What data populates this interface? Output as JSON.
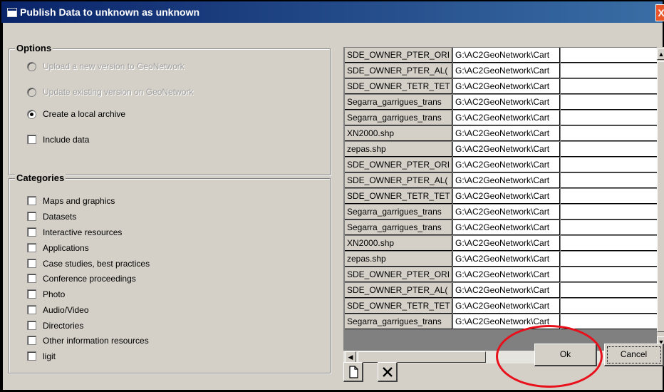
{
  "window": {
    "title": "Publish Data to unknown as unknown",
    "close_label": "X"
  },
  "options": {
    "title": "Options",
    "radios": [
      {
        "label": "Upload a new version to GeoNetwork",
        "selected": false,
        "enabled": false
      },
      {
        "label": "Update existing version on GeoNetwork",
        "selected": false,
        "enabled": false
      },
      {
        "label": "Create a local archive",
        "selected": true,
        "enabled": true
      }
    ],
    "include_data": {
      "label": "Include data",
      "checked": false
    }
  },
  "categories": {
    "title": "Categories",
    "items": [
      "Maps and graphics",
      "Datasets",
      "Interactive resources",
      "Applications",
      "Case studies, best practices",
      "Conference proceedings",
      "Photo",
      "Audio/Video",
      "Directories",
      "Other information resources",
      "ligit"
    ]
  },
  "grid": {
    "rows": [
      [
        "SDE_OWNER_PTER_ORI",
        "G:\\AC2GeoNetwork\\Cart",
        ""
      ],
      [
        "SDE_OWNER_PTER_AL(",
        "G:\\AC2GeoNetwork\\Cart",
        ""
      ],
      [
        "SDE_OWNER_TETR_TET",
        "G:\\AC2GeoNetwork\\Cart",
        ""
      ],
      [
        "Segarra_garrigues_trans",
        "G:\\AC2GeoNetwork\\Cart",
        ""
      ],
      [
        "Segarra_garrigues_trans",
        "G:\\AC2GeoNetwork\\Cart",
        ""
      ],
      [
        "XN2000.shp",
        "G:\\AC2GeoNetwork\\Cart",
        ""
      ],
      [
        "zepas.shp",
        "G:\\AC2GeoNetwork\\Cart",
        ""
      ],
      [
        "SDE_OWNER_PTER_ORI",
        "G:\\AC2GeoNetwork\\Cart",
        ""
      ],
      [
        "SDE_OWNER_PTER_AL(",
        "G:\\AC2GeoNetwork\\Cart",
        ""
      ],
      [
        "SDE_OWNER_TETR_TET",
        "G:\\AC2GeoNetwork\\Cart",
        ""
      ],
      [
        "Segarra_garrigues_trans",
        "G:\\AC2GeoNetwork\\Cart",
        ""
      ],
      [
        "Segarra_garrigues_trans",
        "G:\\AC2GeoNetwork\\Cart",
        ""
      ],
      [
        "XN2000.shp",
        "G:\\AC2GeoNetwork\\Cart",
        ""
      ],
      [
        "zepas.shp",
        "G:\\AC2GeoNetwork\\Cart",
        ""
      ],
      [
        "SDE_OWNER_PTER_ORI",
        "G:\\AC2GeoNetwork\\Cart",
        ""
      ],
      [
        "SDE_OWNER_PTER_AL(",
        "G:\\AC2GeoNetwork\\Cart",
        ""
      ],
      [
        "SDE_OWNER_TETR_TET",
        "G:\\AC2GeoNetwork\\Cart",
        ""
      ],
      [
        "Segarra_garrigues_trans",
        "G:\\AC2GeoNetwork\\Cart",
        ""
      ]
    ]
  },
  "buttons": {
    "ok": "Ok",
    "cancel": "Cancel"
  },
  "toolbar": {
    "new_icon": "new-document-icon",
    "delete_icon": "delete-x-icon"
  },
  "annotation": {
    "color": "#e8101b",
    "shape": "ellipse around Ok button"
  }
}
